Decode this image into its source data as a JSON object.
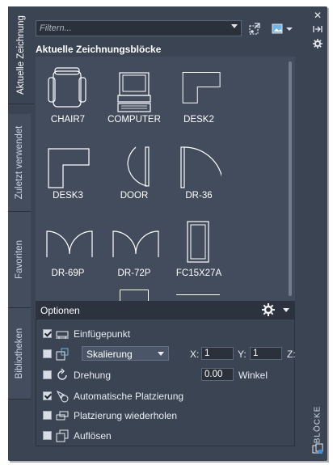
{
  "side_tabs": [
    {
      "label": "Aktuelle Zeichnung",
      "active": true
    },
    {
      "label": "Zuletzt verwendet",
      "active": false
    },
    {
      "label": "Favoriten",
      "active": false
    },
    {
      "label": "Bibliotheken",
      "active": false
    }
  ],
  "palette_title": "BLÖCKE",
  "filter": {
    "placeholder": "Filtern..."
  },
  "section_title": "Aktuelle Zeichnungsblöcke",
  "blocks": [
    {
      "name": "CHAIR7",
      "icon": "chair-icon"
    },
    {
      "name": "COMPUTER",
      "icon": "computer-icon"
    },
    {
      "name": "DESK2",
      "icon": "desk-l-icon"
    },
    {
      "name": "DESK3",
      "icon": "desk-l-icon"
    },
    {
      "name": "DOOR",
      "icon": "door-arc-icon"
    },
    {
      "name": "DR-36",
      "icon": "door-swing-icon"
    },
    {
      "name": "DR-69P",
      "icon": "double-door-icon"
    },
    {
      "name": "DR-72P",
      "icon": "double-door-icon"
    },
    {
      "name": "FC15X27A",
      "icon": "file-cabinet-icon"
    }
  ],
  "options": {
    "title": "Optionen",
    "insertion_point": {
      "label": "Einfügepunkt",
      "checked": true
    },
    "scale": {
      "checked": false,
      "select": "Skalierung",
      "x_label": "X:",
      "x": "1",
      "y_label": "Y:",
      "y": "1",
      "z_label": "Z:"
    },
    "rotation": {
      "label": "Drehung",
      "checked": false,
      "angle": "0.00",
      "angle_label": "Winkel"
    },
    "auto_placement": {
      "label": "Automatische Platzierung",
      "checked": true
    },
    "repeat_placement": {
      "label": "Platzierung wiederholen",
      "checked": false
    },
    "explode": {
      "label": "Auflösen",
      "checked": false
    }
  },
  "colors": {
    "panel": "#3b4453",
    "grid": "#434c5c",
    "header": "#2c333e"
  }
}
